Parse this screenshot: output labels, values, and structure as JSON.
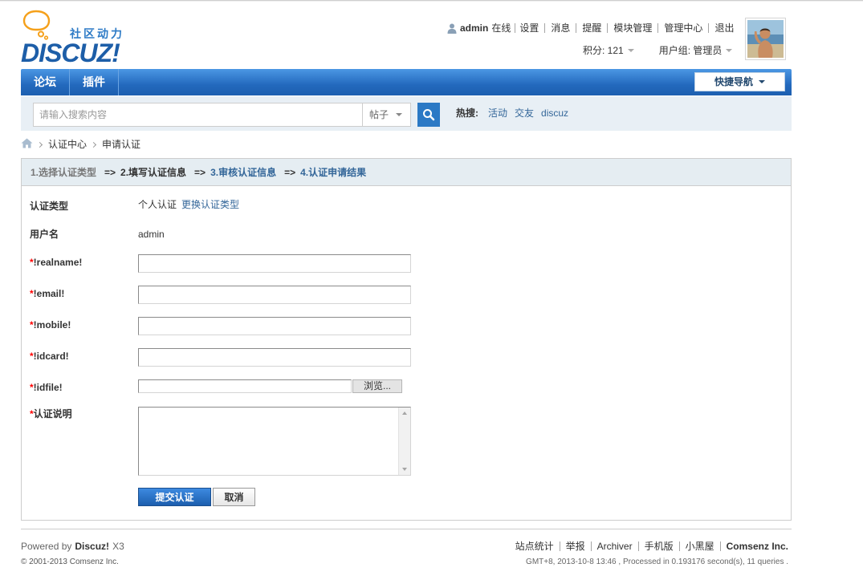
{
  "colors": {
    "brand_blue": "#1d5ea8",
    "logo_orange": "#f5a01a",
    "nav_blue": "#2369bd",
    "link_blue": "#336699",
    "search_bar_bg": "#e8eff5",
    "step_header_bg": "#e5edf2",
    "required_red": "#ff0000"
  },
  "logo": {
    "icon": "speech-bubble-icon",
    "tagline": "社区动力",
    "wordmark": "DISCUZ!"
  },
  "user_bar": {
    "icon": "user-icon",
    "username": "admin",
    "status": "在线",
    "links": [
      "设置",
      "消息",
      "提醒",
      "模块管理",
      "管理中心",
      "退出"
    ],
    "credits": "积分: 121",
    "group": "用户组: 管理员"
  },
  "nav": {
    "items": [
      "论坛",
      "插件"
    ],
    "quick_nav": "快捷导航"
  },
  "search": {
    "placeholder": "请输入搜索内容",
    "type_selected": "帖子",
    "button_icon": "search-icon",
    "hot_label": "热搜:",
    "hot_terms": [
      "活动",
      "交友",
      "discuz"
    ]
  },
  "breadcrumb": {
    "home_icon": "home-icon",
    "items": [
      "认证中心",
      "申请认证"
    ]
  },
  "steps": {
    "items": [
      "1.选择认证类型",
      "2.填写认证信息",
      "3.审核认证信息",
      "4.认证申请结果"
    ],
    "separator": "=>"
  },
  "form": {
    "type_label": "认证类型",
    "type_value": "个人认证",
    "change_type_link": "更换认证类型",
    "username_label": "用户名",
    "username_value": "admin",
    "required_mark": "*",
    "fields": [
      {
        "label": "!realname!"
      },
      {
        "label": "!email!"
      },
      {
        "label": "!mobile!"
      },
      {
        "label": "!idcard!"
      }
    ],
    "file_field": {
      "label": "!idfile!",
      "browse_label": "浏览..."
    },
    "description_label": "认证说明",
    "submit_label": "提交认证",
    "cancel_label": "取消"
  },
  "footer": {
    "powered_prefix": "Powered by",
    "powered_brand": "Discuz!",
    "powered_version": "X3",
    "copyright": "© 2001-2013 Comsenz Inc.",
    "links": [
      "站点统计",
      "举报",
      "Archiver",
      "手机版",
      "小黑屋"
    ],
    "company": "Comsenz Inc.",
    "stats": "GMT+8, 2013-10-8 13:46 , Processed in 0.193176 second(s), 11 queries ."
  }
}
